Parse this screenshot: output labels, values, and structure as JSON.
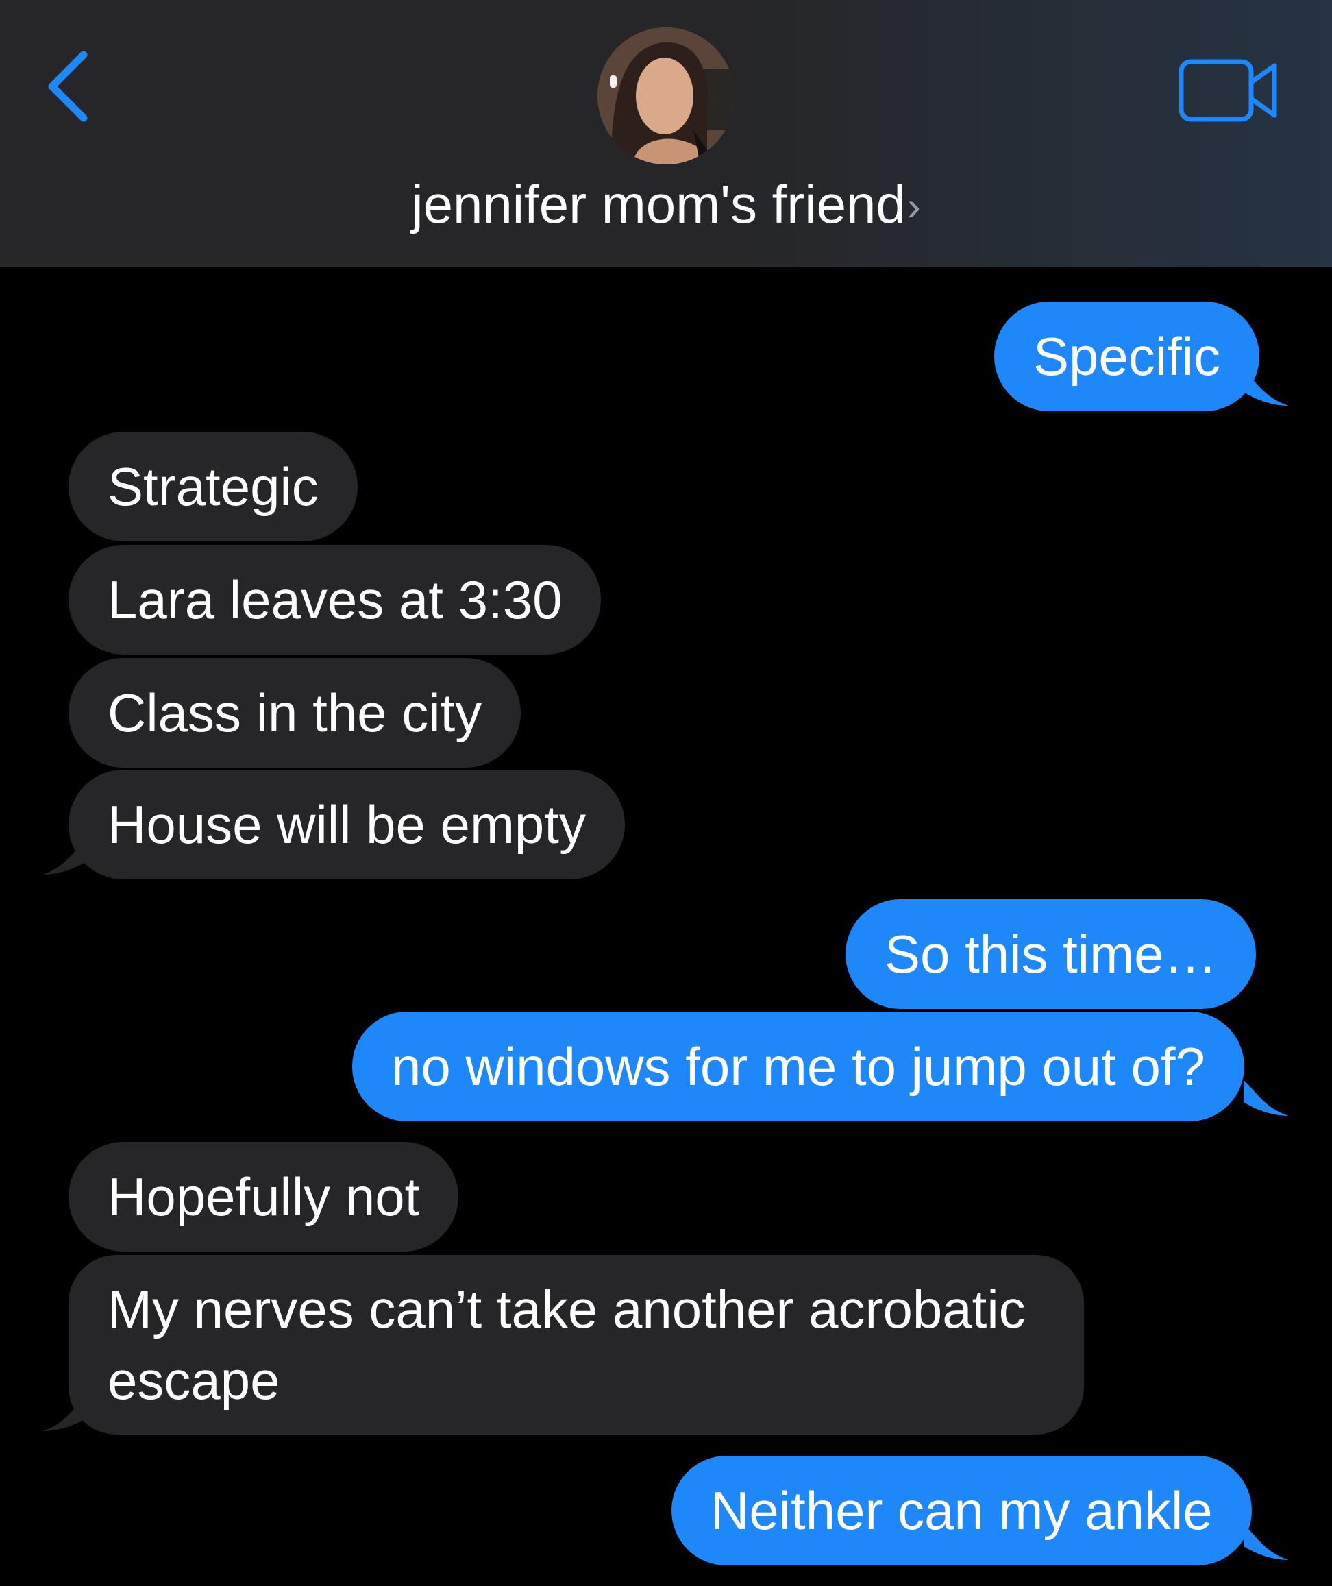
{
  "header": {
    "back_icon": "chevron-left-icon",
    "contact_name": "jennifer mom's friend",
    "name_chevron": "›",
    "video_icon": "video-camera-icon",
    "accent_color": "#1e88fb"
  },
  "colors": {
    "outgoing_bubble": "#1e88fb",
    "incoming_bubble": "#262629",
    "background": "#000000"
  },
  "messages": [
    {
      "direction": "outgoing",
      "text": "Specific"
    },
    {
      "direction": "incoming",
      "text": "Strategic"
    },
    {
      "direction": "incoming",
      "text": "Lara leaves at 3:30"
    },
    {
      "direction": "incoming",
      "text": "Class in the city"
    },
    {
      "direction": "incoming",
      "text": "House will be empty"
    },
    {
      "direction": "outgoing",
      "text": "So this time…"
    },
    {
      "direction": "outgoing",
      "text": "no windows for me to jump out of?"
    },
    {
      "direction": "incoming",
      "text": "Hopefully not"
    },
    {
      "direction": "incoming",
      "text": "My nerves can’t take another acrobatic escape"
    },
    {
      "direction": "outgoing",
      "text": "Neither can my ankle"
    }
  ]
}
